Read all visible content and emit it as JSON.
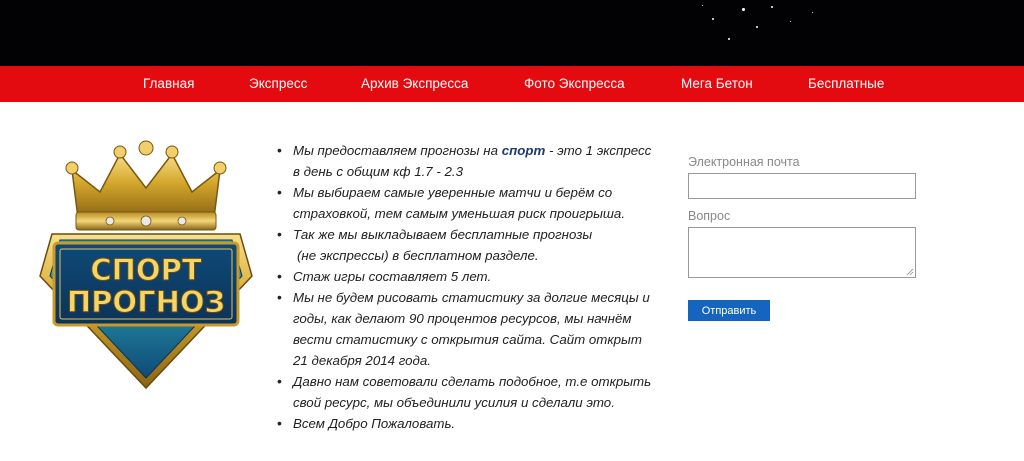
{
  "nav": {
    "items": [
      {
        "label": "Главная"
      },
      {
        "label": "Экспресс"
      },
      {
        "label": "Архив Экспресса"
      },
      {
        "label": "Фото Экспресса"
      },
      {
        "label": "Мега Бетон"
      },
      {
        "label": "Бесплатные"
      }
    ]
  },
  "logo": {
    "line1": "СПОРТ",
    "line2": "ПРОГНОЗ",
    "colors": {
      "gold": "#d4a72c",
      "teal": "#1f7f99",
      "navy": "#0f4a78"
    }
  },
  "content": {
    "item1": {
      "pre": "Мы предоставляем прогнозы на ",
      "link": "спорт",
      "post": " - это 1 экспресс",
      "line2": "в день  с общим кф 1.7 - 2.3"
    },
    "item2": {
      "line1": "Мы выбираем самые уверенные матчи и берём со",
      "line2": "страховкой, тем самым уменьшая риск проигрыша."
    },
    "item3": {
      "line1": "Так же мы выкладываем бесплатные прогнозы",
      "line2": " (не экспрессы) в бесплатном разделе."
    },
    "item4": {
      "line1": "Стаж игры  составляет 5 лет."
    },
    "item5": {
      "line1": "Мы не будем рисовать статистику за долгие месяцы и",
      "line2": "годы, как делают 90 процентов ресурсов, мы начнём",
      "line3": "вести статистику с открытия сайта. Сайт открыт",
      "line4": "21 декабря 2014 года."
    },
    "item6": {
      "line1": "Давно нам советовали сделать подобное, т.е открыть",
      "line2": "свой ресурс, мы объединили усилия и сделали это."
    },
    "item7": {
      "line1": "Всем Добро Пожаловать."
    }
  },
  "form": {
    "email_label": "Электронная почта",
    "email_value": "",
    "question_label": "Вопрос",
    "question_value": "",
    "submit_label": "Отправить"
  },
  "colors": {
    "nav_bg": "#e30b10",
    "banner_bg": "#020204",
    "button_bg": "#1565c0",
    "link": "#1e3a6e"
  }
}
